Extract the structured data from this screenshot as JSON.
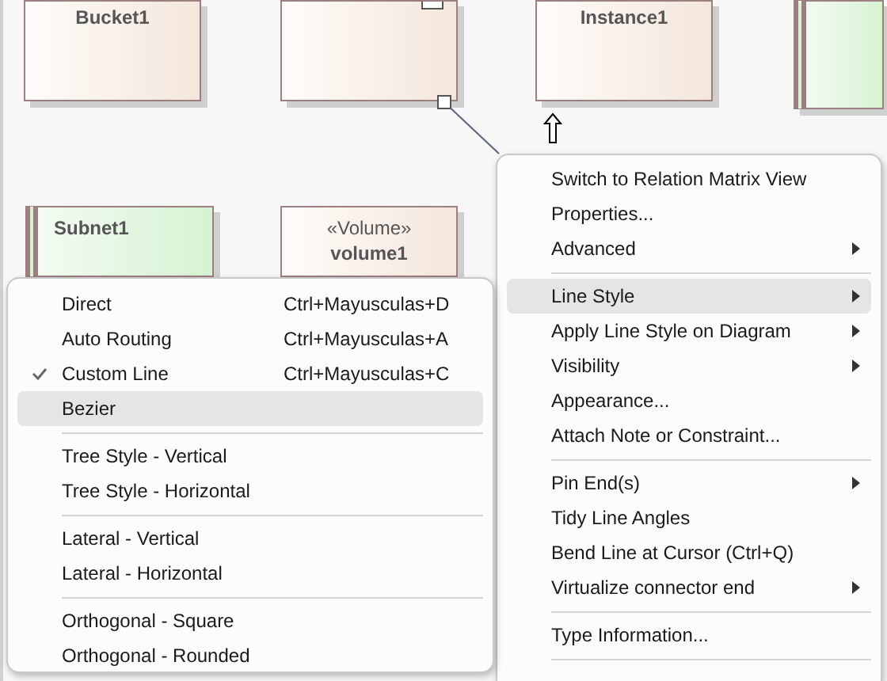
{
  "diagram": {
    "elements": [
      {
        "kind": "artifact",
        "name": "Bucket1"
      },
      {
        "kind": "artifact",
        "has_icon": true
      },
      {
        "kind": "artifact",
        "name": "Instance1"
      },
      {
        "kind": "subnet"
      },
      {
        "kind": "subnet",
        "name": "Subnet1"
      },
      {
        "kind": "artifact",
        "stereotype": "«Volume»",
        "name": "volume1"
      }
    ]
  },
  "context_menu": {
    "items": [
      {
        "kind": "item",
        "label": "Switch to Relation Matrix View",
        "submenu": false,
        "selected": false
      },
      {
        "kind": "item",
        "label": "Properties...",
        "submenu": false,
        "selected": false
      },
      {
        "kind": "item",
        "label": "Advanced",
        "submenu": true,
        "selected": false
      },
      {
        "kind": "separator"
      },
      {
        "kind": "item",
        "label": "Line Style",
        "submenu": true,
        "selected": true
      },
      {
        "kind": "item",
        "label": "Apply Line Style on Diagram",
        "submenu": true,
        "selected": false
      },
      {
        "kind": "item",
        "label": "Visibility",
        "submenu": true,
        "selected": false
      },
      {
        "kind": "item",
        "label": "Appearance...",
        "submenu": false,
        "selected": false
      },
      {
        "kind": "item",
        "label": "Attach Note or Constraint...",
        "submenu": false,
        "selected": false
      },
      {
        "kind": "separator"
      },
      {
        "kind": "item",
        "label": "Pin End(s)",
        "submenu": true,
        "selected": false
      },
      {
        "kind": "item",
        "label": "Tidy Line Angles",
        "submenu": false,
        "selected": false
      },
      {
        "kind": "item",
        "label": "Bend Line at Cursor (Ctrl+Q)",
        "submenu": false,
        "selected": false
      },
      {
        "kind": "item",
        "label": "Virtualize connector end",
        "submenu": true,
        "selected": false
      },
      {
        "kind": "separator"
      },
      {
        "kind": "item",
        "label": "Type Information...",
        "submenu": false,
        "selected": false
      },
      {
        "kind": "separator"
      }
    ]
  },
  "line_style_submenu": {
    "items": [
      {
        "kind": "item",
        "label": "Direct",
        "shortcut": "Ctrl+Mayusculas+D",
        "checked": false,
        "selected": false
      },
      {
        "kind": "item",
        "label": "Auto Routing",
        "shortcut": "Ctrl+Mayusculas+A",
        "checked": false,
        "selected": false
      },
      {
        "kind": "item",
        "label": "Custom Line",
        "shortcut": "Ctrl+Mayusculas+C",
        "checked": true,
        "selected": false
      },
      {
        "kind": "item",
        "label": "Bezier",
        "checked": false,
        "selected": true
      },
      {
        "kind": "separator"
      },
      {
        "kind": "item",
        "label": "Tree Style - Vertical",
        "checked": false,
        "selected": false
      },
      {
        "kind": "item",
        "label": "Tree Style - Horizontal",
        "checked": false,
        "selected": false
      },
      {
        "kind": "separator"
      },
      {
        "kind": "item",
        "label": "Lateral - Vertical",
        "checked": false,
        "selected": false
      },
      {
        "kind": "item",
        "label": "Lateral - Horizontal",
        "checked": false,
        "selected": false
      },
      {
        "kind": "separator"
      },
      {
        "kind": "item",
        "label": "Orthogonal - Square",
        "checked": false,
        "selected": false
      },
      {
        "kind": "item",
        "label": "Orthogonal - Rounded",
        "checked": false,
        "selected": false
      }
    ]
  }
}
